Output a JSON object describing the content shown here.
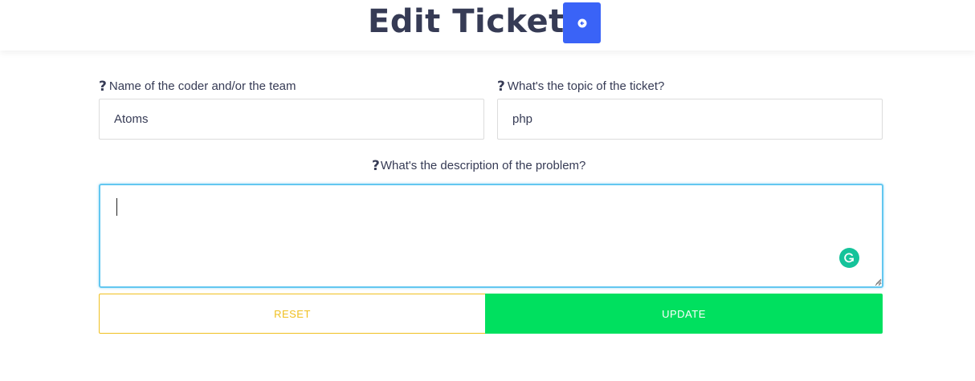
{
  "header": {
    "title": "Edit Ticket",
    "back_icon": "arrow-left-circle-icon"
  },
  "form": {
    "coder": {
      "label": "Name of the coder and/or the team",
      "help_icon": "question-mark-icon",
      "value": "Atoms"
    },
    "topic": {
      "label": "What's the topic of the ticket?",
      "help_icon": "question-mark-icon",
      "value": "php"
    },
    "description": {
      "label": "What's the description of the problem?",
      "help_icon": "question-mark-icon",
      "value": "",
      "focused": true
    },
    "reset_label": "RESET",
    "update_label": "UPDATE"
  },
  "colors": {
    "title": "#363b55",
    "back_button": "#3a63f7",
    "focus_border": "#63c7f0",
    "reset": "#f0c020",
    "update": "#00e05f",
    "grammarly": "#15c39a"
  }
}
